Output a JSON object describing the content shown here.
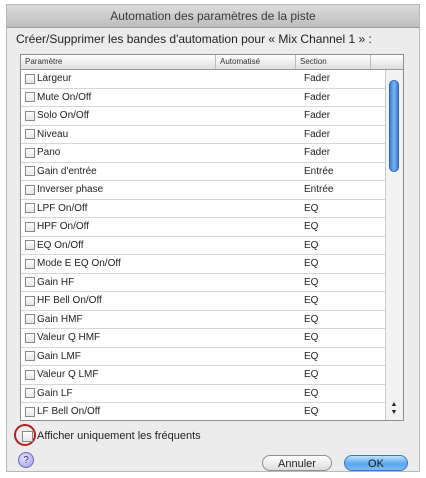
{
  "window": {
    "title": "Automation des paramètres de la piste"
  },
  "prompt": "Créer/Supprimer les bandes d'automation pour « Mix Channel 1 » :",
  "table": {
    "columns": [
      "Paramètre",
      "Automatisé",
      "Section",
      ""
    ],
    "rows": [
      {
        "param": "Largeur",
        "section": "Fader"
      },
      {
        "param": "Mute On/Off",
        "section": "Fader"
      },
      {
        "param": "Solo On/Off",
        "section": "Fader"
      },
      {
        "param": "Niveau",
        "section": "Fader"
      },
      {
        "param": "Pano",
        "section": "Fader"
      },
      {
        "param": "Gain d'entrée",
        "section": "Entrée"
      },
      {
        "param": "Inverser phase",
        "section": "Entrée"
      },
      {
        "param": "LPF On/Off",
        "section": "EQ"
      },
      {
        "param": "HPF On/Off",
        "section": "EQ"
      },
      {
        "param": "EQ On/Off",
        "section": "EQ"
      },
      {
        "param": "Mode E EQ On/Off",
        "section": "EQ"
      },
      {
        "param": "Gain HF",
        "section": "EQ"
      },
      {
        "param": "HF Bell On/Off",
        "section": "EQ"
      },
      {
        "param": "Gain HMF",
        "section": "EQ"
      },
      {
        "param": "Valeur Q HMF",
        "section": "EQ"
      },
      {
        "param": "Gain LMF",
        "section": "EQ"
      },
      {
        "param": "Valeur Q LMF",
        "section": "EQ"
      },
      {
        "param": "Gain LF",
        "section": "EQ"
      },
      {
        "param": "LF Bell On/Off",
        "section": "EQ"
      }
    ]
  },
  "scroll": {
    "up": "▲",
    "down": "▼"
  },
  "options": {
    "show_frequent_label": "Afficher uniquement les fréquents"
  },
  "help": {
    "glyph": "?"
  },
  "buttons": {
    "cancel": "Annuler",
    "ok": "OK"
  },
  "colors": {
    "accent": "#5aa6ee",
    "highlight_circle": "#b02222"
  }
}
